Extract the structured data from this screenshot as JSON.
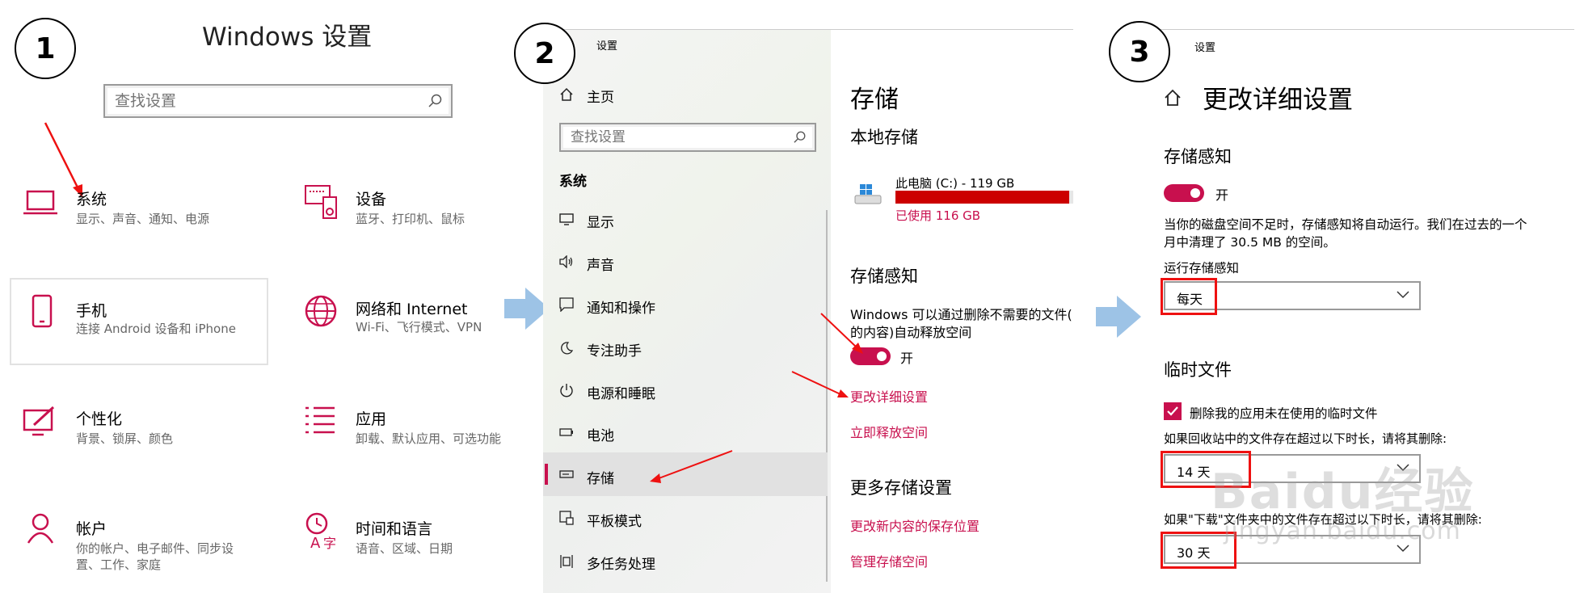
{
  "steps": [
    "1",
    "2",
    "3"
  ],
  "panel1": {
    "title": "Windows 设置",
    "search_placeholder": "查找设置",
    "tiles": [
      {
        "title": "系统",
        "sub": "显示、声音、通知、电源",
        "icon": "laptop-icon"
      },
      {
        "title": "设备",
        "sub": "蓝牙、打印机、鼠标",
        "icon": "keyboard-icon"
      },
      {
        "title": "手机",
        "sub": "连接 Android 设备和 iPhone",
        "icon": "phone-icon"
      },
      {
        "title": "网络和 Internet",
        "sub": "Wi-Fi、飞行模式、VPN",
        "icon": "globe-icon"
      },
      {
        "title": "个性化",
        "sub": "背景、锁屏、颜色",
        "icon": "paint-icon"
      },
      {
        "title": "应用",
        "sub": "卸载、默认应用、可选功能",
        "icon": "apps-list-icon"
      },
      {
        "title": "帐户",
        "sub1": "你的帐户、电子邮件、同步设",
        "sub2": "置、工作、家庭",
        "icon": "person-icon"
      },
      {
        "title": "时间和语言",
        "sub": "语音、区域、日期",
        "icon": "time-language-icon"
      }
    ]
  },
  "panel2": {
    "window_title": "设置",
    "home": "主页",
    "search_placeholder": "查找设置",
    "section": "系统",
    "nav": [
      "显示",
      "声音",
      "通知和操作",
      "专注助手",
      "电源和睡眠",
      "电池",
      "存储",
      "平板模式",
      "多任务处理"
    ],
    "heading": "存储",
    "local_storage": "本地存储",
    "drive_label": "此电脑 (C:) - 119 GB",
    "drive_used": "已使用 116 GB",
    "drive_used_fraction": 0.975,
    "sense_heading": "存储感知",
    "sense_desc1": "Windows 可以通过删除不需要的文件(",
    "sense_desc2": "的内容)自动释放空间",
    "toggle_label": "开",
    "link_change": "更改详细设置",
    "link_free": "立即释放空间",
    "more_heading": "更多存储设置",
    "link_save_location": "更改新内容的保存位置",
    "link_manage": "管理存储空间"
  },
  "panel3": {
    "window_title": "设置",
    "heading": "更改详细设置",
    "sense_heading": "存储感知",
    "toggle_label": "开",
    "desc1": "当你的磁盘空间不足时，存储感知将自动运行。我们在过去的一个",
    "desc2": "月中清理了 30.5 MB 的空间。",
    "run_label": "运行存储感知",
    "run_value": "每天",
    "temp_heading": "临时文件",
    "checkbox_label": "删除我的应用未在使用的临时文件",
    "recycle_label": "如果回收站中的文件存在超过以下时长，请将其删除:",
    "recycle_value": "14 天",
    "downloads_label": "如果\"下载\"文件夹中的文件存在超过以下时长，请将其删除:",
    "downloads_value": "30 天"
  },
  "watermark": {
    "brand": "Baidu经验",
    "url": "jingyan.baidu.com"
  },
  "colors": {
    "accent": "#c8104e",
    "highlight": "#e11111",
    "arrow": "#9dc3e6",
    "drive_bar": "#cc0000"
  }
}
